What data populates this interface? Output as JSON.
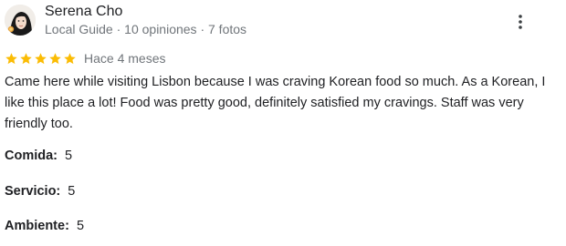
{
  "author": {
    "name": "Serena Cho",
    "meta": "Local Guide · 10 opiniones · 7 fotos",
    "avatar_icon": "profile-photo-icon"
  },
  "menu": {
    "icon": "more-vert-icon"
  },
  "rating": {
    "stars": 5,
    "max_stars": 5,
    "star_color": "#fbbc04",
    "date": "Hace 4 meses"
  },
  "review": {
    "text": "Came here while visiting Lisbon because I was craving Korean food so much. As a Korean, I like this place a lot! Food was pretty good, definitely satisfied my cravings. Staff was very friendly too."
  },
  "subratings": [
    {
      "label": "Comida:",
      "value": "5"
    },
    {
      "label": "Servicio:",
      "value": "5"
    },
    {
      "label": "Ambiente:",
      "value": "5"
    }
  ]
}
